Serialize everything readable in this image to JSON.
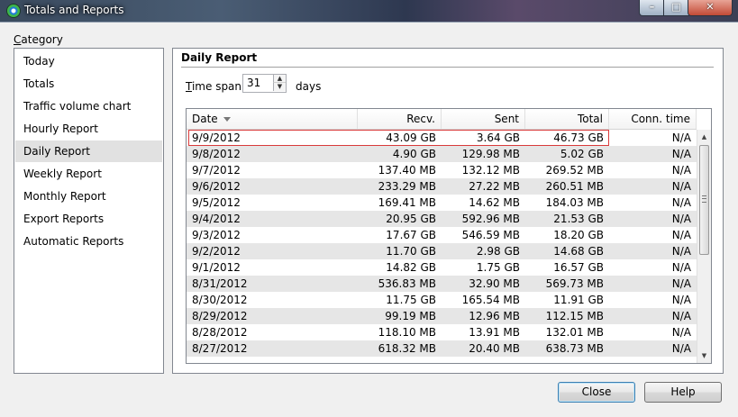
{
  "window": {
    "title": "Totals and Reports"
  },
  "sidebar": {
    "label_prefix": "C",
    "label_rest": "ategory",
    "items": [
      {
        "label": "Today"
      },
      {
        "label": "Totals"
      },
      {
        "label": "Traffic volume chart"
      },
      {
        "label": "Hourly Report"
      },
      {
        "label": "Daily Report"
      },
      {
        "label": "Weekly Report"
      },
      {
        "label": "Monthly Report"
      },
      {
        "label": "Export Reports"
      },
      {
        "label": "Automatic Reports"
      }
    ],
    "selected": "Daily Report"
  },
  "report": {
    "title": "Daily Report",
    "timespan_prefix": "T",
    "timespan_rest": "ime span:",
    "timespan_value": "31",
    "days_label": "days"
  },
  "table": {
    "columns": [
      "Date",
      "Recv.",
      "Sent",
      "Total",
      "Conn. time"
    ],
    "rows": [
      [
        "9/9/2012",
        "43.09 GB",
        "3.64 GB",
        "46.73 GB",
        "N/A"
      ],
      [
        "9/8/2012",
        "4.90 GB",
        "129.98 MB",
        "5.02 GB",
        "N/A"
      ],
      [
        "9/7/2012",
        "137.40 MB",
        "132.12 MB",
        "269.52 MB",
        "N/A"
      ],
      [
        "9/6/2012",
        "233.29 MB",
        "27.22 MB",
        "260.51 MB",
        "N/A"
      ],
      [
        "9/5/2012",
        "169.41 MB",
        "14.62 MB",
        "184.03 MB",
        "N/A"
      ],
      [
        "9/4/2012",
        "20.95 GB",
        "592.96 MB",
        "21.53 GB",
        "N/A"
      ],
      [
        "9/3/2012",
        "17.67 GB",
        "546.59 MB",
        "18.20 GB",
        "N/A"
      ],
      [
        "9/2/2012",
        "11.70 GB",
        "2.98 GB",
        "14.68 GB",
        "N/A"
      ],
      [
        "9/1/2012",
        "14.82 GB",
        "1.75 GB",
        "16.57 GB",
        "N/A"
      ],
      [
        "8/31/2012",
        "536.83 MB",
        "32.90 MB",
        "569.73 MB",
        "N/A"
      ],
      [
        "8/30/2012",
        "11.75 GB",
        "165.54 MB",
        "11.91 GB",
        "N/A"
      ],
      [
        "8/29/2012",
        "99.19 MB",
        "12.96 MB",
        "112.15 MB",
        "N/A"
      ],
      [
        "8/28/2012",
        "118.10 MB",
        "13.91 MB",
        "132.01 MB",
        "N/A"
      ],
      [
        "8/27/2012",
        "618.32 MB",
        "20.40 MB",
        "638.73 MB",
        "N/A"
      ]
    ],
    "selected_row": 0
  },
  "buttons": {
    "close": "Close",
    "help": "Help"
  },
  "icons": {
    "app": "network-monitor-icon",
    "sort": "sort-descending-icon",
    "spin_up": "spin-up-arrow",
    "spin_down": "spin-down-arrow",
    "scroll_up": "scroll-up-arrow",
    "scroll_down": "scroll-down-arrow"
  },
  "colors": {
    "selection_border": "#d93a3a",
    "alt_row": "#e6e6e6",
    "default_button_border": "#3c7fb1"
  }
}
